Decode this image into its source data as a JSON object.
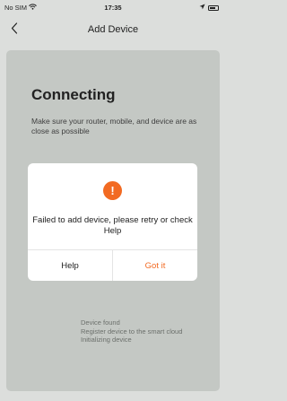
{
  "status_bar": {
    "carrier": "No SIM",
    "time": "17:35",
    "wifi_icon": "wifi-icon",
    "location_icon": "location-arrow-icon",
    "battery_icon": "battery-icon"
  },
  "nav": {
    "back_icon": "chevron-left-icon",
    "title": "Add Device"
  },
  "main": {
    "title": "Connecting",
    "description": "Make sure your router, mobile, and device are as close as possible",
    "steps": [
      "Device found",
      "Register device to the smart cloud",
      "Initializing device"
    ]
  },
  "dialog": {
    "icon": "alert-icon",
    "icon_glyph": "!",
    "message": "Failed to add device, please retry or check Help",
    "help_label": "Help",
    "confirm_label": "Got it"
  },
  "colors": {
    "accent": "#f26a22",
    "overlay": "#c4c8c4",
    "dialog_bg": "#ffffff"
  }
}
